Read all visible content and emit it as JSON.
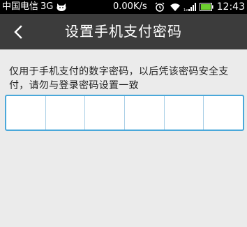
{
  "status_bar": {
    "carrier": "中国电信",
    "network": "3G",
    "speed": "0.00K/s",
    "time": "12:43"
  },
  "title_bar": {
    "title": "设置手机支付密码",
    "back_icon": "chevron-left-icon"
  },
  "main": {
    "description": "仅用于手机支付的数字密码，以后凭该密码安全支付，请勿与登录密码设置一致",
    "pin": {
      "digit_count": 6,
      "values": [
        "",
        "",
        "",
        "",
        "",
        ""
      ]
    }
  },
  "colors": {
    "status_bar_bg": "#000000",
    "title_bar_bg": "#3c3c3c",
    "page_bg": "#ebebeb",
    "pin_border": "#4aa8da",
    "battery_green": "#6ccf2f"
  }
}
